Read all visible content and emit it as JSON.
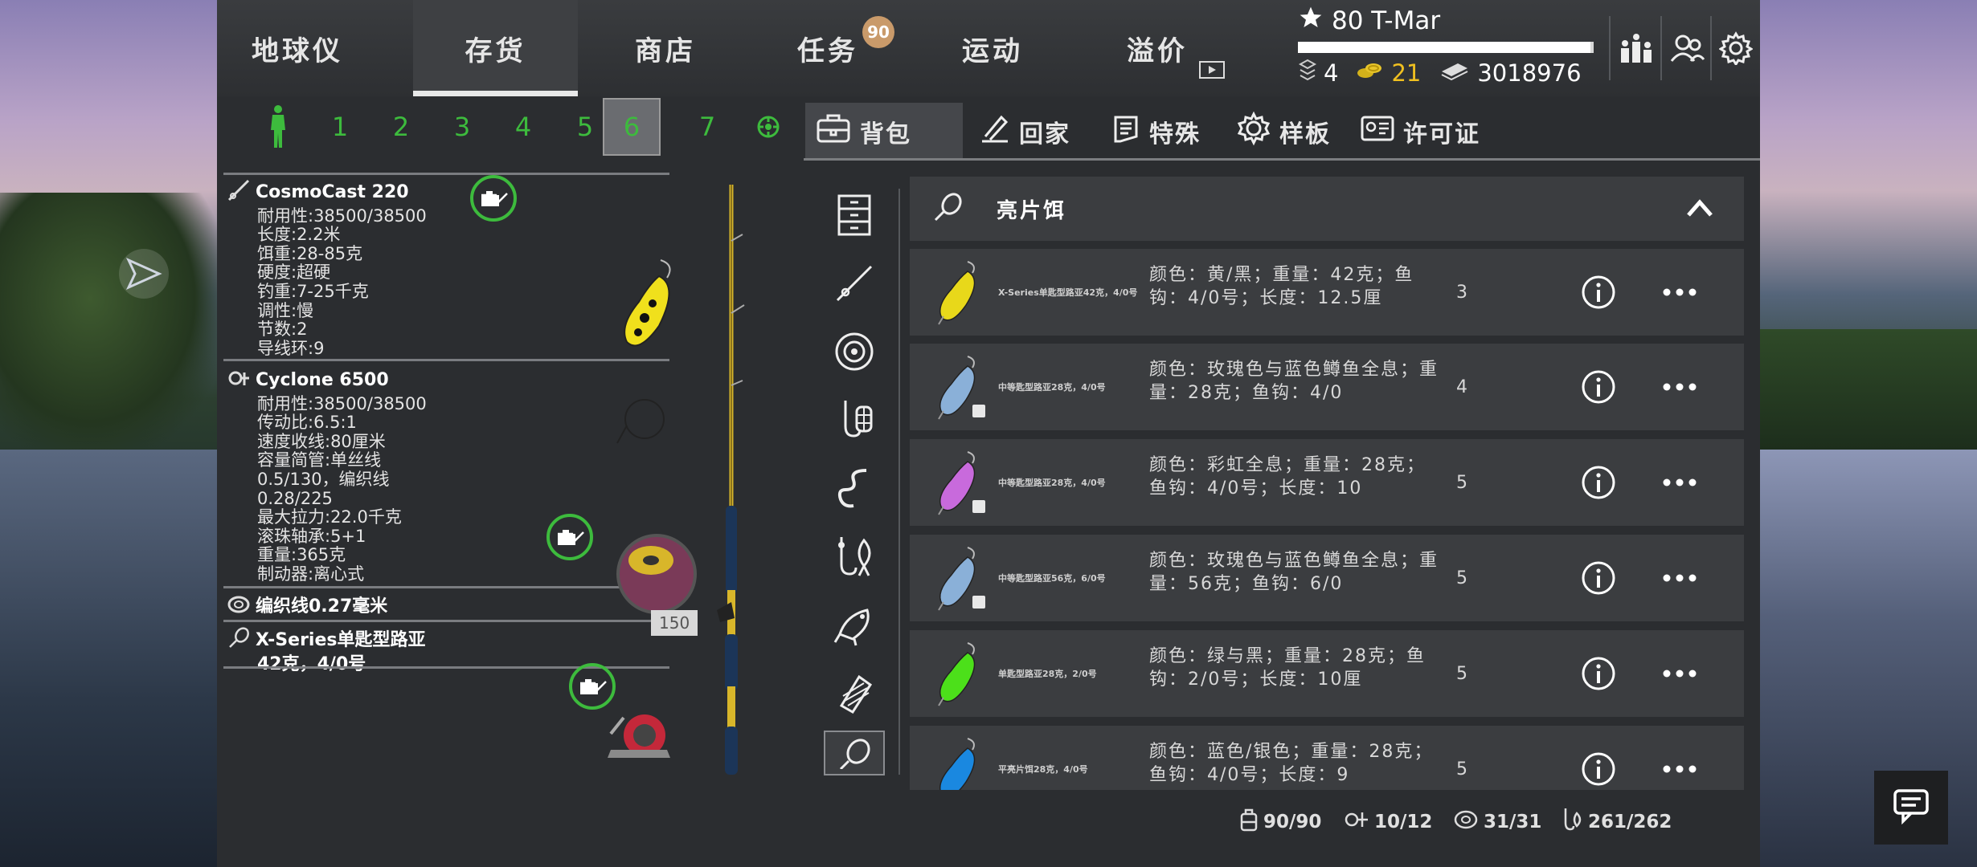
{
  "nav": {
    "tabs": [
      {
        "label": "地球仪"
      },
      {
        "label": "存货"
      },
      {
        "label": "商店"
      },
      {
        "label": "任务"
      },
      {
        "label": "运动"
      },
      {
        "label": "溢价"
      }
    ],
    "quest_badge": "90",
    "active_tab": "存货"
  },
  "player": {
    "level_name": "80 T-Mar",
    "xp_fraction": 0.99,
    "stars": "4",
    "gold": "21",
    "silver": "3018976"
  },
  "slots": {
    "tabs": [
      "1",
      "2",
      "3",
      "4",
      "5",
      "6",
      "7"
    ],
    "active": "6"
  },
  "rod": {
    "name": "CosmoCast 220",
    "specs": [
      "耐用性:38500/38500",
      "长度:2.2米",
      "饵重:28-85克",
      "硬度:超硬",
      "钓重:7-25千克",
      "调性:慢",
      "节数:2",
      "导线环:9"
    ]
  },
  "reel": {
    "name": "Cyclone 6500",
    "specs": [
      "耐用性:38500/38500",
      "传动比:6.5:1",
      "速度收线:80厘米",
      "容量简管:单丝线",
      "0.5/130，编织线",
      "0.28/225",
      "最大拉力:22.0千克",
      "滚珠轴承:5+1",
      "重量:365克",
      "制动器:离心式"
    ]
  },
  "line": {
    "name": "编织线0.27毫米",
    "length_label": "150"
  },
  "lure_equipped": {
    "name_line1": "X-Series单匙型路亚",
    "name_line2": "42克，4/0号"
  },
  "subtabs": [
    {
      "label": "背包"
    },
    {
      "label": "回家"
    },
    {
      "label": "特殊"
    },
    {
      "label": "样板"
    },
    {
      "label": "许可证"
    }
  ],
  "category_header": "亮片饵",
  "items": [
    {
      "name": "X-Series单匙型路亚42克，4/0号",
      "desc": "颜色：黄/黑；重量：42克；鱼钩：4/0号；长度：12.5厘",
      "qty": "3",
      "color": "#e8d81a",
      "night": false
    },
    {
      "name": "中等匙型路亚28克，4/0号",
      "desc": "颜色：玫瑰色与蓝色鳟鱼全息；重量：28克；鱼钩：4/0",
      "qty": "4",
      "color": "#8ab0d8",
      "night": true
    },
    {
      "name": "中等匙型路亚28克，4/0号",
      "desc": "颜色：彩虹全息；重量：28克；鱼钩：4/0号；长度：10",
      "qty": "5",
      "color": "#c86adc",
      "night": true
    },
    {
      "name": "中等匙型路亚56克，6/0号",
      "desc": "颜色：玫瑰色与蓝色鳟鱼全息；重量：56克；鱼钩：6/0",
      "qty": "5",
      "color": "#8ab0d8",
      "night": true
    },
    {
      "name": "单匙型路亚28克，2/0号",
      "desc": "颜色：绿与黑；重量：28克；鱼钩：2/0号；长度：10厘",
      "qty": "5",
      "color": "#4ce01a",
      "night": false
    },
    {
      "name": "平亮片饵28克，4/0号",
      "desc": "颜色：蓝色/银色；重量：28克；鱼钩：4/0号；长度：9",
      "qty": "5",
      "color": "#1a88e0",
      "night": false
    }
  ],
  "bottom_stats": {
    "bag": "90/90",
    "rods": "10/12",
    "lines": "31/31",
    "baits": "261/262"
  }
}
